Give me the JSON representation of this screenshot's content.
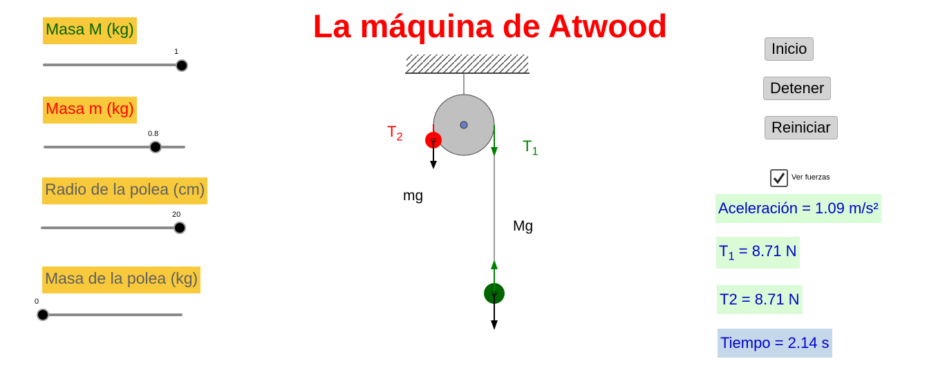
{
  "title": "La máquina de Atwood",
  "sliders": [
    {
      "label": "Masa M (kg)",
      "value": "1",
      "label_color": "#006400"
    },
    {
      "label": "Masa m (kg)",
      "value": "0.8",
      "label_color": "#ff0000"
    },
    {
      "label": "Radio de la polea (cm)",
      "value": "20",
      "label_color": "#606060"
    },
    {
      "label": "Masa de la polea (kg)",
      "value": "0",
      "label_color": "#606060"
    }
  ],
  "buttons": {
    "start": "Inicio",
    "stop": "Detener",
    "reset": "Reiniciar"
  },
  "checkbox": {
    "label": "Ver fuerzas",
    "checked": true
  },
  "info": {
    "acceleration": "Aceleración = 1.09 m/s²",
    "t1_prefix": "T",
    "t1_sub": "1",
    "t1_value": " = 8.71 N",
    "t2": "T2 = 8.71 N",
    "time": "Tiempo = 2.14 s"
  },
  "diagram": {
    "t2_main": "T",
    "t2_sub": "2",
    "t1_main": "T",
    "t1_sub": "1",
    "mg": "mg",
    "Mg": "Mg"
  },
  "colors": {
    "title": "#ff0000",
    "label_bg": "#f8c93b",
    "info_text": "#0000cc",
    "info_green_bg": "#d9fbd6",
    "info_blue_bg": "#c5d8ea",
    "small_mass": "#ff0000",
    "large_mass": "#006400",
    "force_green": "#008000"
  }
}
